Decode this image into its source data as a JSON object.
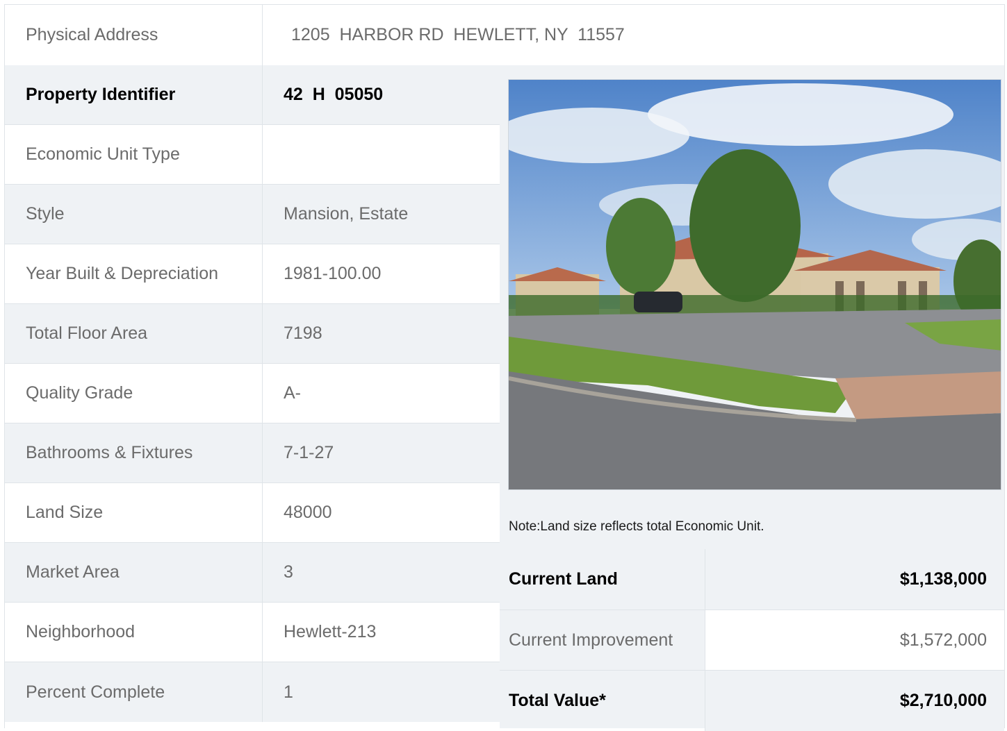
{
  "address": {
    "label": "Physical Address",
    "value": "1205  HARBOR RD  HEWLETT, NY  11557"
  },
  "rows": [
    {
      "label": "Property Identifier",
      "value": "42  H  05050"
    },
    {
      "label": "Economic Unit Type",
      "value": ""
    },
    {
      "label": "Style",
      "value": "Mansion, Estate"
    },
    {
      "label": "Year Built & Depreciation",
      "value": "1981-100.00"
    },
    {
      "label": "Total Floor Area",
      "value": "7198"
    },
    {
      "label": "Quality Grade",
      "value": "A-"
    },
    {
      "label": "Bathrooms & Fixtures",
      "value": "7-1-27"
    },
    {
      "label": "Land Size",
      "value": "48000"
    },
    {
      "label": "Market Area",
      "value": "3"
    },
    {
      "label": "Neighborhood",
      "value": "Hewlett-213"
    },
    {
      "label": "Percent Complete",
      "value": "1"
    }
  ],
  "note": "Note:Land size reflects total Economic Unit.",
  "values": [
    {
      "label": "Current Land",
      "amount": "$1,138,000"
    },
    {
      "label": "Current Improvement",
      "amount": "$1,572,000"
    },
    {
      "label": "Total Value*",
      "amount": "$2,710,000"
    }
  ],
  "colors": {
    "row_shade": "#eff2f5",
    "border": "#dfe4e8",
    "text_muted": "#6b6b6b",
    "text_strong": "#000000"
  }
}
